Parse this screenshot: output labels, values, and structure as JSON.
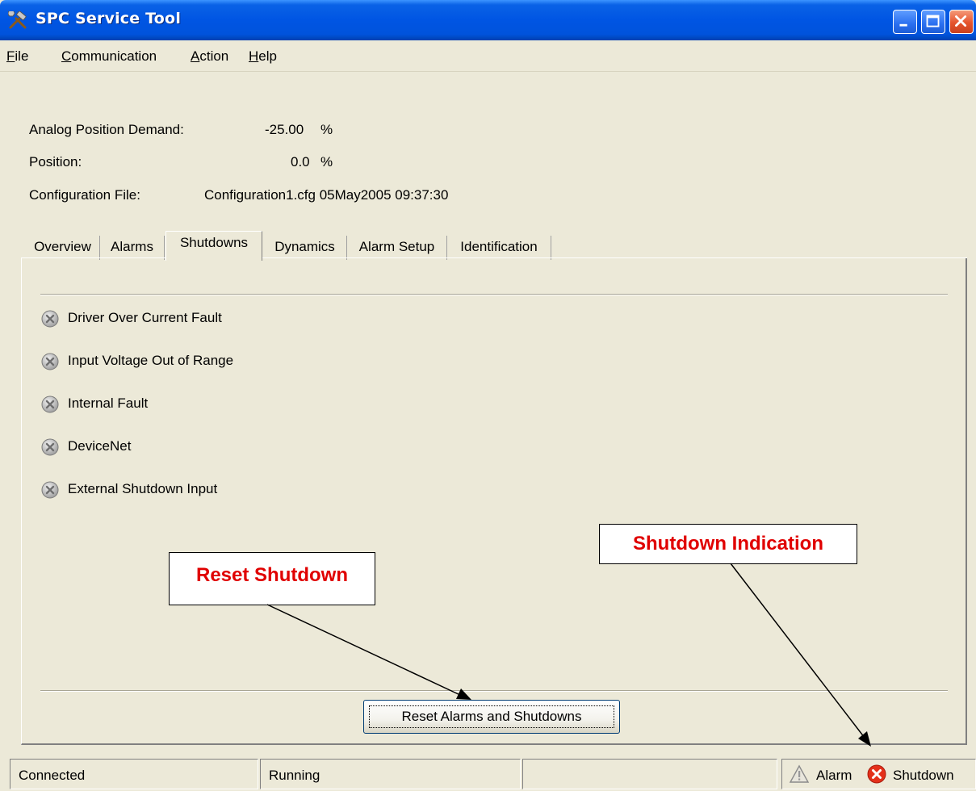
{
  "window": {
    "title": "SPC Service Tool",
    "accent": "#0055e3"
  },
  "menu": {
    "file": {
      "key": "F",
      "rest": "ile"
    },
    "communication": {
      "key": "C",
      "rest": "ommunication"
    },
    "action": {
      "key": "A",
      "rest": "ction"
    },
    "help": {
      "key": "H",
      "rest": "elp"
    }
  },
  "info": {
    "analog_label": "Analog Position Demand:",
    "analog_value": "-25.00",
    "analog_unit": "%",
    "position_label": "Position:",
    "position_value": "0.0",
    "position_unit": "%",
    "config_label": "Configuration File:",
    "config_value": "Configuration1.cfg 05May2005 09:37:30"
  },
  "tabs": [
    {
      "label": "Overview"
    },
    {
      "label": "Alarms"
    },
    {
      "label": "Shutdowns",
      "active": true
    },
    {
      "label": "Dynamics"
    },
    {
      "label": "Alarm Setup"
    },
    {
      "label": "Identification"
    }
  ],
  "shutdowns": [
    {
      "label": "Driver Over Current Fault",
      "icon": "inactive-x-icon"
    },
    {
      "label": "Input Voltage Out of Range",
      "icon": "inactive-x-icon"
    },
    {
      "label": "Internal Fault",
      "icon": "inactive-x-icon"
    },
    {
      "label": "DeviceNet",
      "icon": "inactive-x-icon"
    },
    {
      "label": "External Shutdown Input",
      "icon": "inactive-x-icon"
    }
  ],
  "reset_button": {
    "label": "Reset Alarms and Shutdowns"
  },
  "callouts": {
    "reset": "Reset Shutdown",
    "indication": "Shutdown Indication",
    "color": "#e00000"
  },
  "status": {
    "connection": "Connected",
    "state": "Running",
    "empty": "",
    "alarm_label": "Alarm",
    "shutdown_label": "Shutdown"
  }
}
